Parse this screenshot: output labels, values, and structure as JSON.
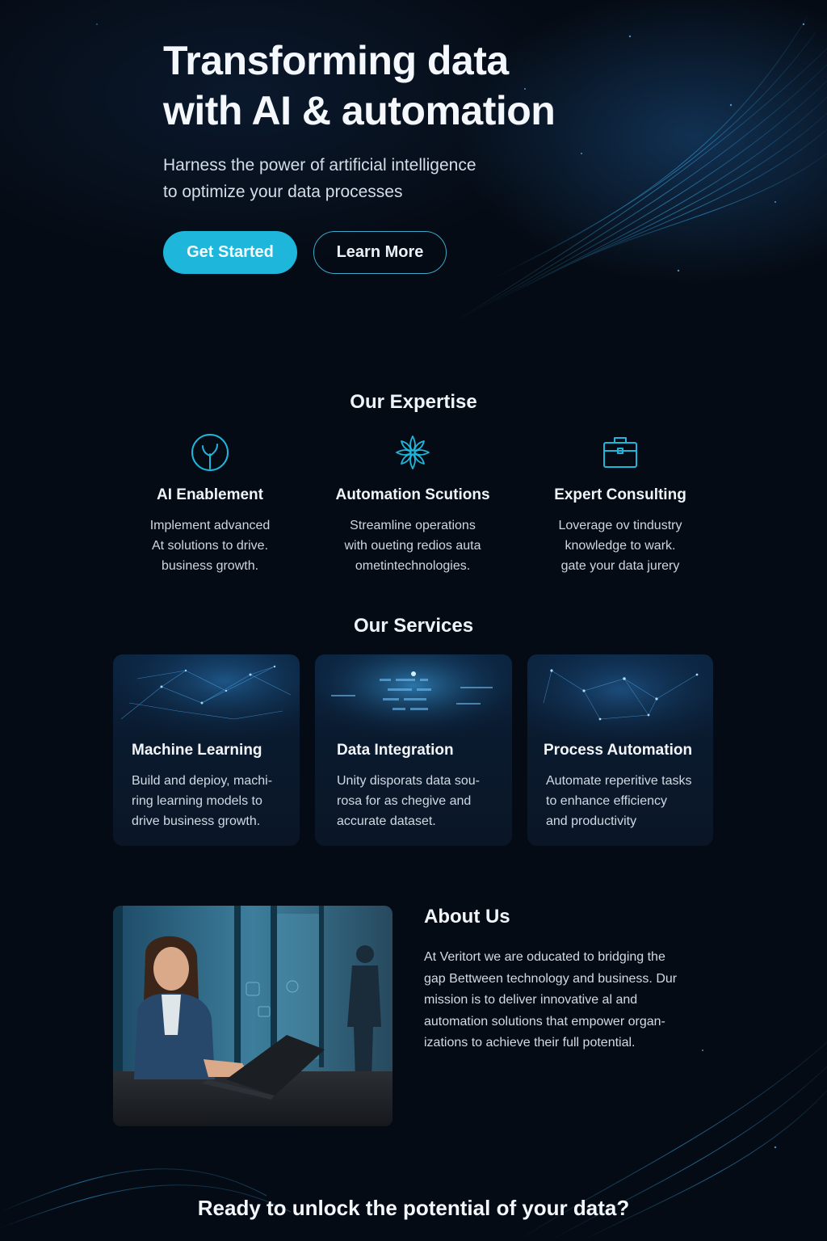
{
  "hero": {
    "title_line1": "Transforming data",
    "title_line2": "with AI & automation",
    "subtitle_line1": "Harness the power of artificial intelligence",
    "subtitle_line2": "to optimize your data processes",
    "primary_button": "Get Started",
    "secondary_button": "Learn More"
  },
  "expertise": {
    "heading": "Our Expertise",
    "items": [
      {
        "icon": "sprout-icon",
        "title": "AI Enablement",
        "lines": [
          "Implement advanced",
          "At solutions to drive.",
          "business growth."
        ]
      },
      {
        "icon": "flower-icon",
        "title": "Automation Scutions",
        "lines": [
          "Streamline operations",
          "with oueting redios auta",
          "ometintechnologies."
        ]
      },
      {
        "icon": "briefcase-icon",
        "title": "Expert Consulting",
        "lines": [
          "Loverage ov tindustry",
          "knowledge to wark.",
          "gate your data jurery"
        ]
      }
    ]
  },
  "services": {
    "heading": "Our Services",
    "items": [
      {
        "title": "Machine Learning",
        "lines": [
          "Build and depioy, machi-",
          "ring learning models to",
          "drive business growth."
        ]
      },
      {
        "title": "Data Integration",
        "lines": [
          "Unity disporats data sou-",
          "rosa for as chegive and",
          "accurate dataset."
        ]
      },
      {
        "title": "Process Automation",
        "lines": [
          "Automate reperitive tasks",
          "to enhance efficiency",
          "and productivity"
        ]
      }
    ]
  },
  "about": {
    "heading": "About Us",
    "lines": [
      "At Veritort we are oducated to bridging the",
      "gap Bettween technology and business. Dur",
      "mission is to deliver innovative al and",
      "automation solutions that empower organ-",
      "izations to achieve their full potential."
    ]
  },
  "cta": {
    "text": "Ready to unlock the potential of your data?"
  },
  "colors": {
    "background": "#050b14",
    "accent": "#1fb6dc",
    "card": "#0b2440"
  }
}
